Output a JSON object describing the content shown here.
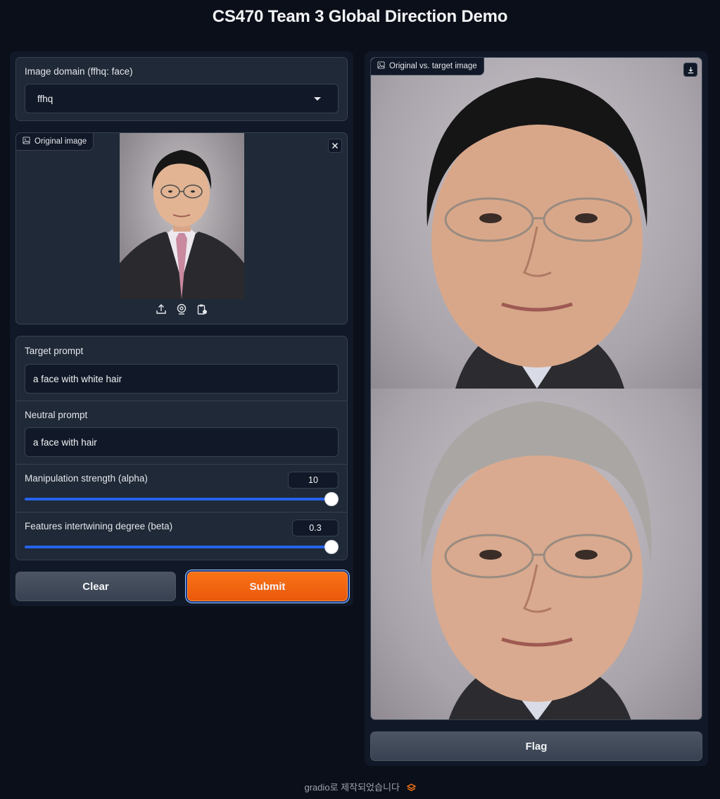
{
  "app": {
    "title": "CS470 Team 3 Global Direction Demo"
  },
  "domain": {
    "label": "Image domain (ffhq: face)",
    "value": "ffhq"
  },
  "original_image": {
    "label": "Original image"
  },
  "target_prompt": {
    "label": "Target prompt",
    "value": "a face with white hair"
  },
  "neutral_prompt": {
    "label": "Neutral prompt",
    "value": "a face with hair"
  },
  "alpha": {
    "label": "Manipulation strength (alpha)",
    "value": "10",
    "level": 1.0
  },
  "beta": {
    "label": "Features intertwining degree (beta)",
    "value": "0.3",
    "level": 1.0
  },
  "buttons": {
    "clear": "Clear",
    "submit": "Submit",
    "flag": "Flag"
  },
  "output": {
    "label": "Original vs. target image"
  },
  "footer": {
    "text": "gradio로 제작되었습니다"
  },
  "colors": {
    "accent": "#f97316",
    "slider": "#2563eb",
    "background": "#0b0f19",
    "panel": "#1f2937"
  },
  "icons": [
    "image-icon",
    "close-icon",
    "upload-icon",
    "webcam-icon",
    "clipboard-icon",
    "download-icon",
    "chevron-down-icon",
    "gradio-logo-icon"
  ]
}
